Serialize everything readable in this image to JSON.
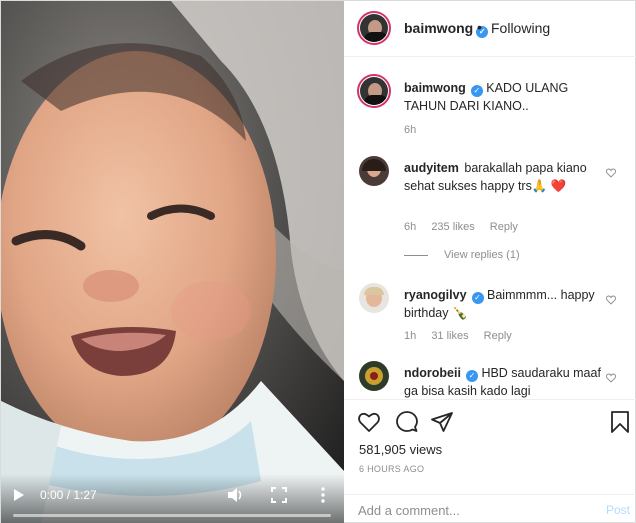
{
  "video": {
    "time": "0:00 / 1:27",
    "progress": 0.0,
    "icons": [
      "play-icon",
      "volume-icon",
      "fullscreen-icon",
      "more-options-icon"
    ]
  },
  "header": {
    "username": "baimwong",
    "separator": "•",
    "follow_status": "Following"
  },
  "caption": {
    "username": "baimwong",
    "text": "KADO ULANG TAHUN DARI KIANO..",
    "time": "6h"
  },
  "comments": [
    {
      "username": "audyitem",
      "text": "barakallah papa kiano sehat sukses happy trs🙏 ❤️",
      "time": "6h",
      "likes": "235 likes",
      "reply": "Reply",
      "view_replies": "View replies (1)"
    },
    {
      "username": "ryanogilvy",
      "text": "Baimmmm... happy birthday 🍾",
      "time": "1h",
      "likes": "31 likes",
      "reply": "Reply"
    },
    {
      "username": "ndorobeii",
      "text": "HBD saudaraku maaf ga bisa kasih kado lagi"
    }
  ],
  "stats": {
    "views": "581,905 views",
    "ago": "6 HOURS AGO"
  },
  "add_comment": {
    "placeholder": "Add a comment...",
    "post_label": "Post"
  },
  "colors": {
    "verified_blue": "#3897f0",
    "link_gray": "#8e8e8e",
    "post_disabled": "#b3dbff",
    "heart_red": "#ed4956"
  }
}
